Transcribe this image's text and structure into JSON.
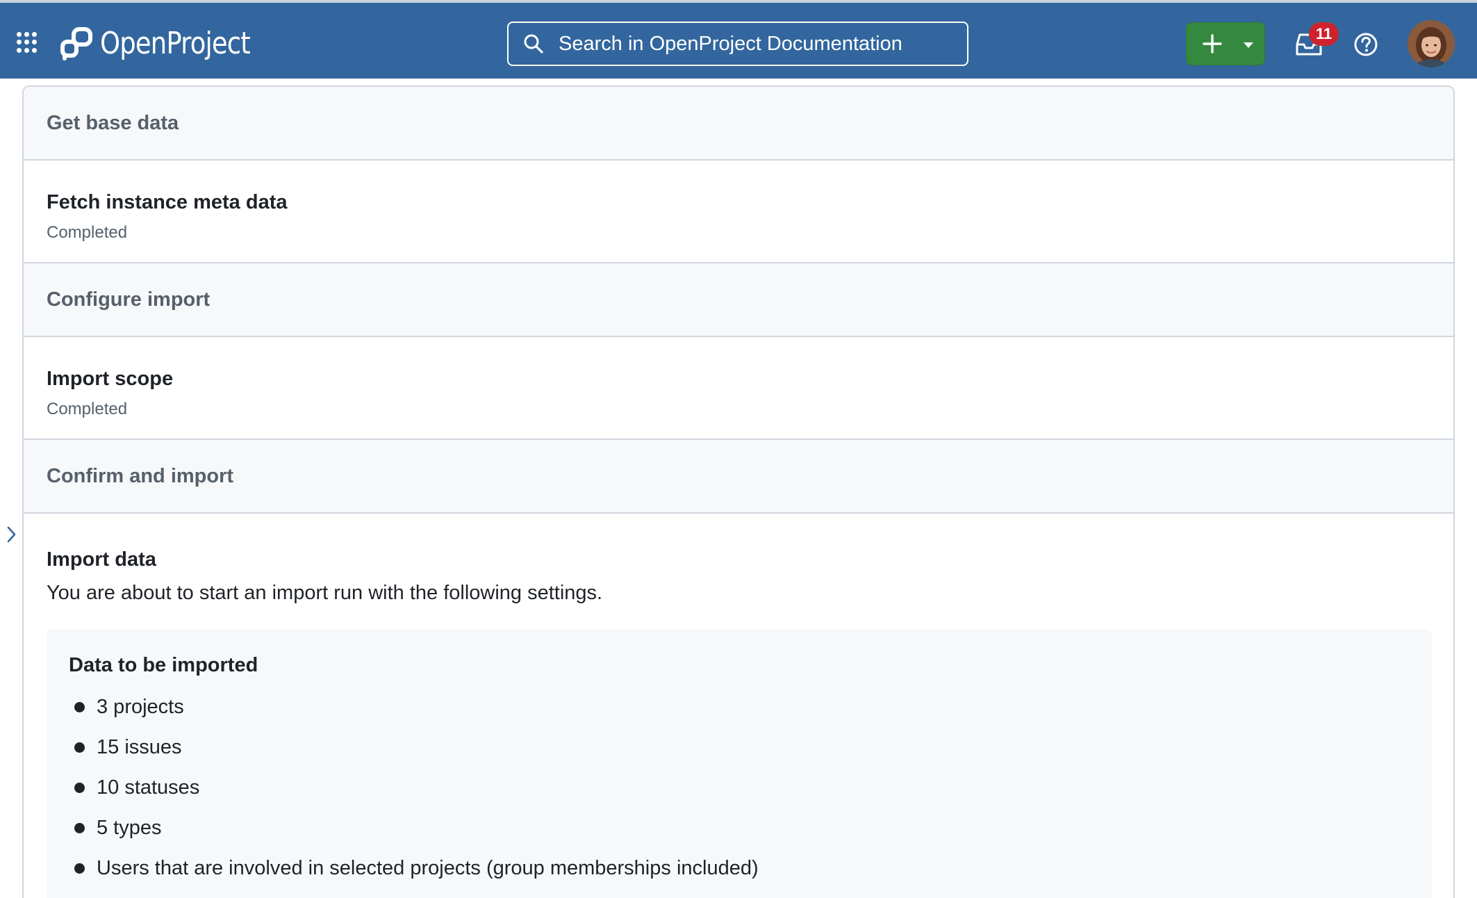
{
  "header": {
    "app_name": "OpenProject",
    "search_placeholder": "Search in OpenProject Documentation",
    "notification_count": "11",
    "colors": {
      "bar": "#33669e",
      "create_button": "#35893e",
      "badge": "#cf222e"
    },
    "icons": [
      "grid-menu-icon",
      "openproject-logo-icon",
      "search-icon",
      "plus-icon",
      "caret-down-icon",
      "inbox-icon",
      "help-icon"
    ]
  },
  "sections": {
    "base_data": {
      "title": "Get base data",
      "step_title": "Fetch instance meta data",
      "step_status": "Completed"
    },
    "configure": {
      "title": "Configure import",
      "step_title": "Import scope",
      "step_status": "Completed"
    },
    "confirm": {
      "title": "Confirm and import",
      "step_title": "Import data",
      "step_description": "You are about to start an import run with the following settings."
    }
  },
  "data_box": {
    "title": "Data to be imported",
    "items": [
      "3 projects",
      "15 issues",
      "10 statuses",
      "5 types",
      "Users that are involved in selected projects (group memberships included)"
    ]
  }
}
